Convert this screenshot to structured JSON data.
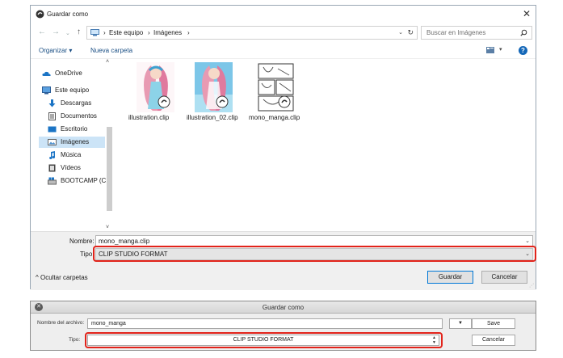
{
  "windows_dialog": {
    "title": "Guardar como",
    "close_glyph": "✕",
    "nav": {
      "back": "←",
      "forward": "→",
      "dropdown": "⌄",
      "up": "↑"
    },
    "address": {
      "separator": "›",
      "crumbs": [
        "Este equipo",
        "Imágenes"
      ],
      "dropdown": "⌄",
      "refresh": "↻"
    },
    "search_placeholder": "Buscar en Imágenes",
    "toolbar": {
      "organize": "Organizar ▾",
      "new_folder": "Nueva carpeta",
      "view_dropdown": "▾",
      "help": "?"
    },
    "sidebar": {
      "items": [
        {
          "label": "OneDrive",
          "icon": "cloud-icon"
        },
        {
          "label": "Este equipo",
          "icon": "computer-icon"
        },
        {
          "label": "Descargas",
          "icon": "download-icon"
        },
        {
          "label": "Documentos",
          "icon": "document-icon"
        },
        {
          "label": "Escritorio",
          "icon": "desktop-icon"
        },
        {
          "label": "Imágenes",
          "icon": "pictures-icon",
          "selected": true
        },
        {
          "label": "Música",
          "icon": "music-icon"
        },
        {
          "label": "Vídeos",
          "icon": "video-icon"
        },
        {
          "label": "BOOTCAMP (C:)",
          "icon": "drive-icon"
        }
      ],
      "scroll_up": "˄",
      "scroll_down": "˅"
    },
    "files": [
      {
        "name": "illustration.clip"
      },
      {
        "name": "illustration_02.clip"
      },
      {
        "name": "mono_manga.clip"
      }
    ],
    "bottom": {
      "name_label": "Nombre:",
      "name_value": "mono_manga.clip",
      "type_label": "Tipo:",
      "type_value": "CLIP STUDIO FORMAT",
      "dropdown": "⌄",
      "hide_folders": "^ Ocultar carpetas",
      "save": "Guardar",
      "cancel": "Cancelar",
      "grip": "⋰"
    },
    "highlight_color": "#e2231a"
  },
  "mac_dialog": {
    "title": "Guardar como",
    "close_glyph": "✕",
    "name_label": "Nombre del archivo:",
    "name_value": "mono_manga",
    "dropdown_button": "▼",
    "save": "Save",
    "type_label": "Tipo:",
    "type_value": "CLIP STUDIO FORMAT",
    "spin_up": "▲",
    "spin_down": "▼",
    "cancel": "Cancelar"
  }
}
